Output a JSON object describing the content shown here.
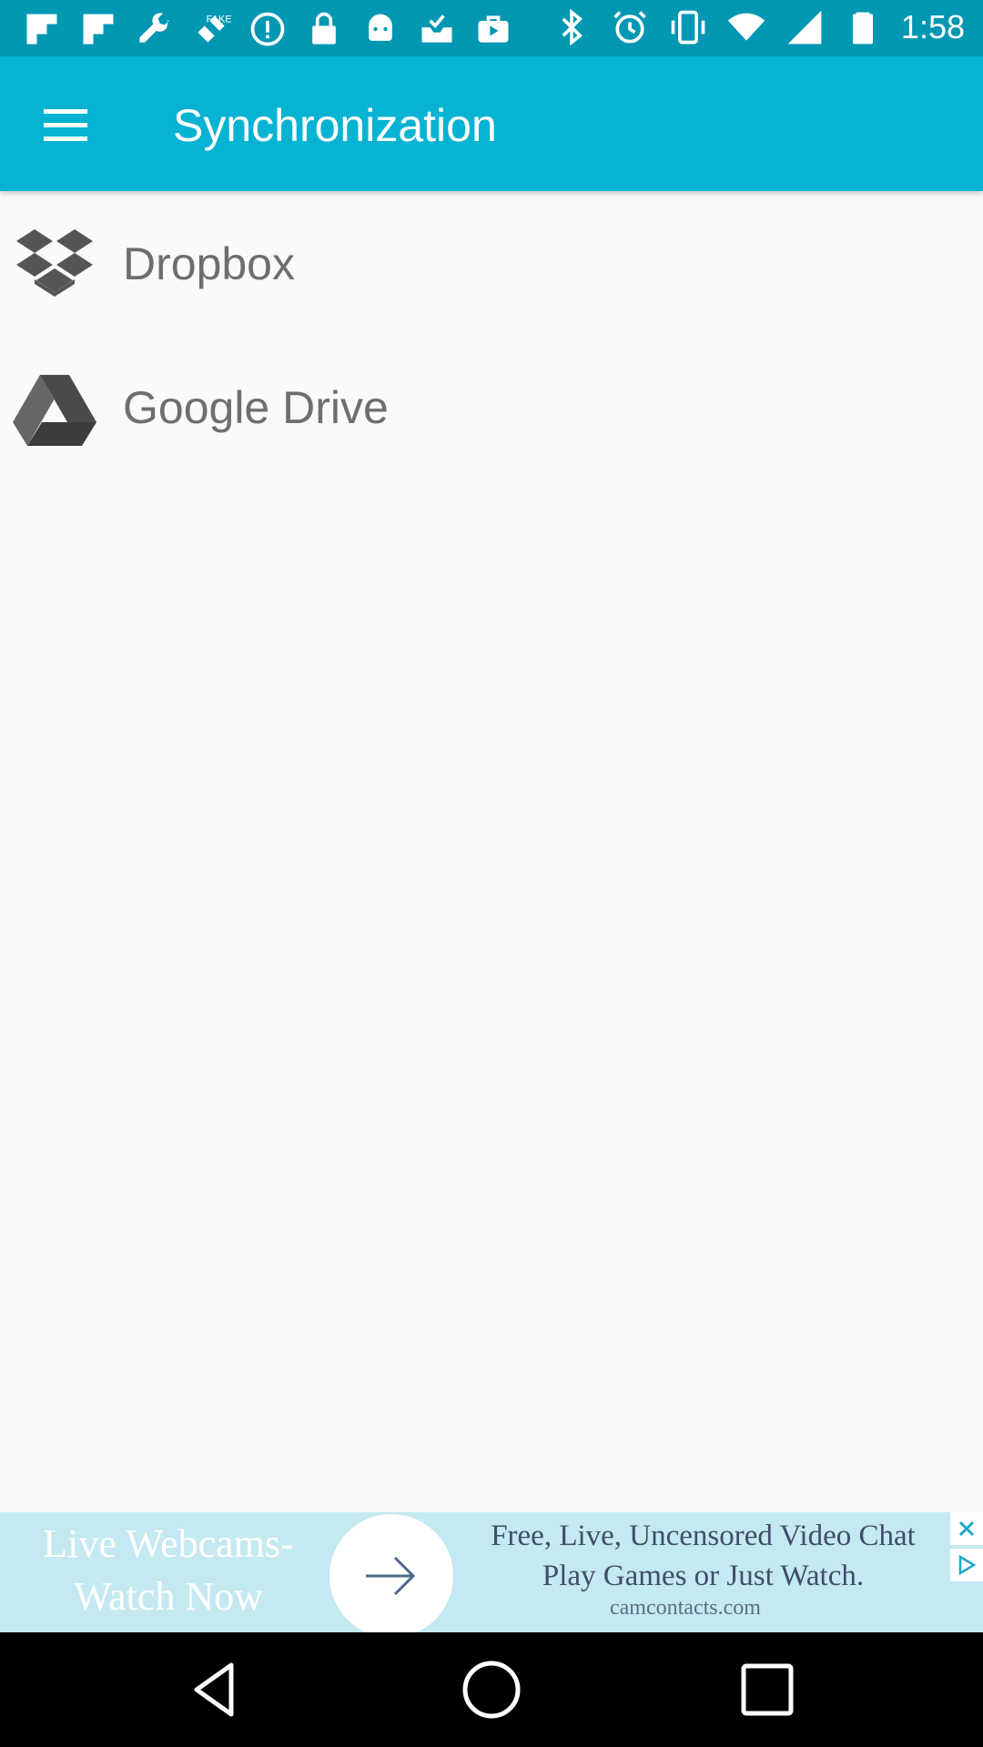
{
  "status_bar": {
    "time": "1:58",
    "left_icons": [
      "flipboard-icon",
      "flipboard-icon",
      "wrench-icon",
      "fake-gps-icon",
      "info-icon",
      "lock-icon",
      "android-icon",
      "inbox-icon",
      "briefcase-icon"
    ],
    "right_icons": [
      "bluetooth-icon",
      "alarm-icon",
      "vibrate-icon",
      "wifi-icon",
      "signal-icon",
      "battery-icon"
    ]
  },
  "app_bar": {
    "title": "Synchronization",
    "menu_icon": "hamburger-menu-icon",
    "color": "#06b3d2"
  },
  "list": {
    "items": [
      {
        "label": "Dropbox",
        "icon": "dropbox-icon"
      },
      {
        "label": "Google Drive",
        "icon": "google-drive-icon"
      }
    ]
  },
  "ad": {
    "left_line1": "Live Webcams-",
    "left_line2": "Watch Now",
    "right_line1": "Free, Live, Uncensored Video Chat",
    "right_line2": "Play Games or Just Watch.",
    "domain": "camcontacts.com"
  },
  "nav_bar": {
    "buttons": [
      "back-icon",
      "home-icon",
      "recents-icon"
    ]
  }
}
